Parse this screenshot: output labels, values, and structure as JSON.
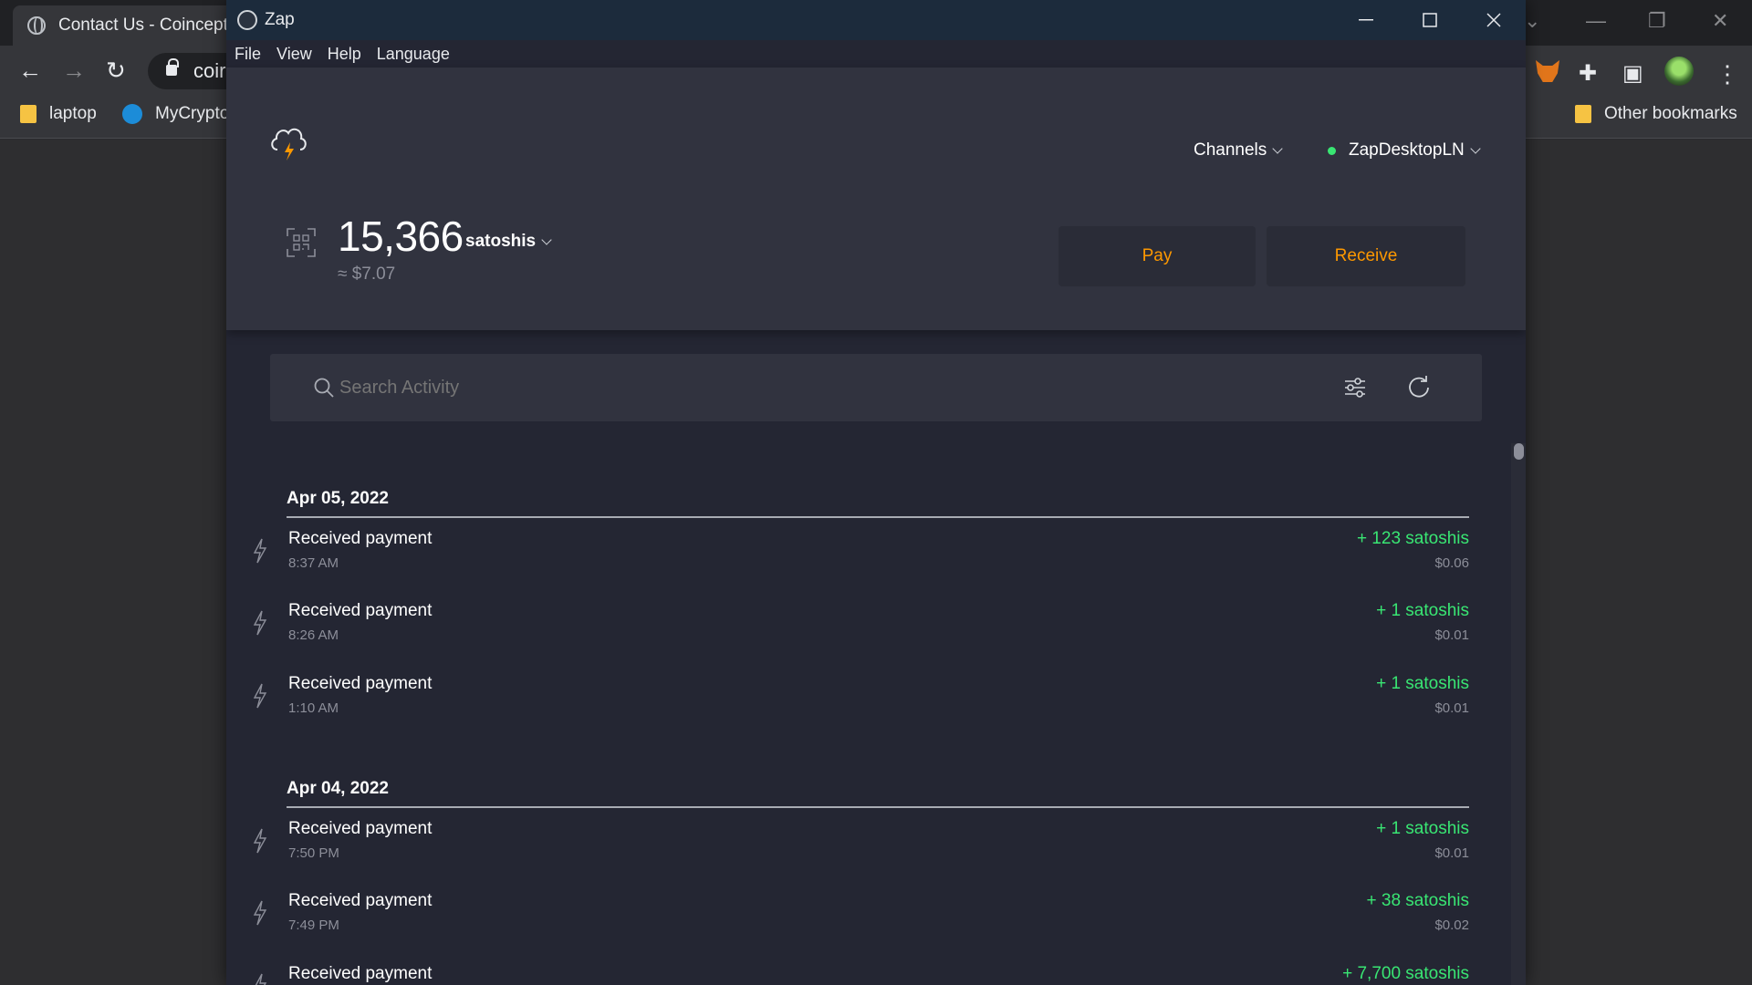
{
  "browser": {
    "tab_title": "Contact Us - Coincept",
    "address_partial": "coir",
    "bookmarks": [
      {
        "label": "laptop"
      },
      {
        "label": "MyCrypto"
      }
    ],
    "other_bookmarks_label": "Other bookmarks"
  },
  "app": {
    "title": "Zap",
    "menu": [
      "File",
      "View",
      "Help",
      "Language"
    ]
  },
  "header": {
    "channels_label": "Channels",
    "node_name": "ZapDesktopLN",
    "node_status_color": "#39e673",
    "balance": "15,366",
    "unit": "satoshis",
    "fiat": "≈ $7.07",
    "pay_label": "Pay",
    "receive_label": "Receive",
    "accent_color": "#fd9800"
  },
  "search": {
    "placeholder": "Search Activity"
  },
  "activity": [
    {
      "date": "Apr 05, 2022",
      "items": [
        {
          "title": "Received payment",
          "time": "8:37 AM",
          "amount": "+ 123 satoshis",
          "fiat": "$0.06"
        },
        {
          "title": "Received payment",
          "time": "8:26 AM",
          "amount": "+ 1 satoshis",
          "fiat": "$0.01"
        },
        {
          "title": "Received payment",
          "time": "1:10 AM",
          "amount": "+ 1 satoshis",
          "fiat": "$0.01"
        }
      ]
    },
    {
      "date": "Apr 04, 2022",
      "items": [
        {
          "title": "Received payment",
          "time": "7:50 PM",
          "amount": "+ 1 satoshis",
          "fiat": "$0.01"
        },
        {
          "title": "Received payment",
          "time": "7:49 PM",
          "amount": "+ 38 satoshis",
          "fiat": "$0.02"
        },
        {
          "title": "Received payment",
          "time": "",
          "amount": "+ 7,700 satoshis",
          "fiat": ""
        }
      ]
    }
  ]
}
